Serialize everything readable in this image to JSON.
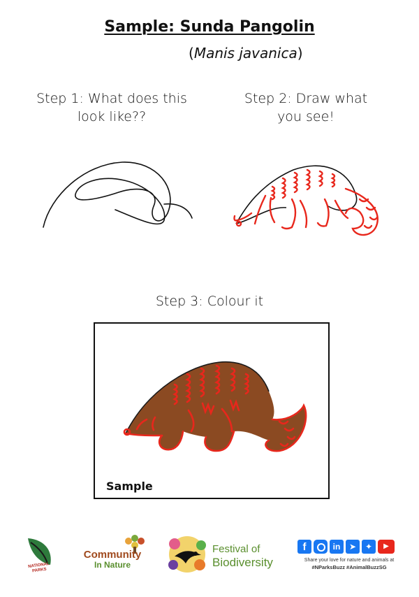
{
  "header": {
    "title": "Sample: Sunda Pangolin",
    "scientific_name": "Manis javanica"
  },
  "steps": [
    {
      "line1": "Step 1: What does this",
      "line2": "look like??"
    },
    {
      "line1": "Step 2: Draw what",
      "line2": "you see!"
    },
    {
      "line1": "Step 3: Colour it"
    }
  ],
  "sample_label": "Sample",
  "footer": {
    "logo_nparks_line1": "NATIONAL",
    "logo_nparks_line2": "PARKS",
    "community_line1": "Community",
    "community_line2": "In Nature",
    "festival_line1": "Festival of",
    "festival_line2": "Biodiversity",
    "social_text1": "Share your love for nature and animals at",
    "social_text2": "#NParksBuzz #AnimalBuzzSG"
  },
  "colors": {
    "scribble": "#111111",
    "outline_red": "#e8271c",
    "body_brown": "#8b4a22",
    "frame_border": "#111111",
    "festival_green": "#5a8f2e",
    "social_blue": "#1877f2"
  }
}
